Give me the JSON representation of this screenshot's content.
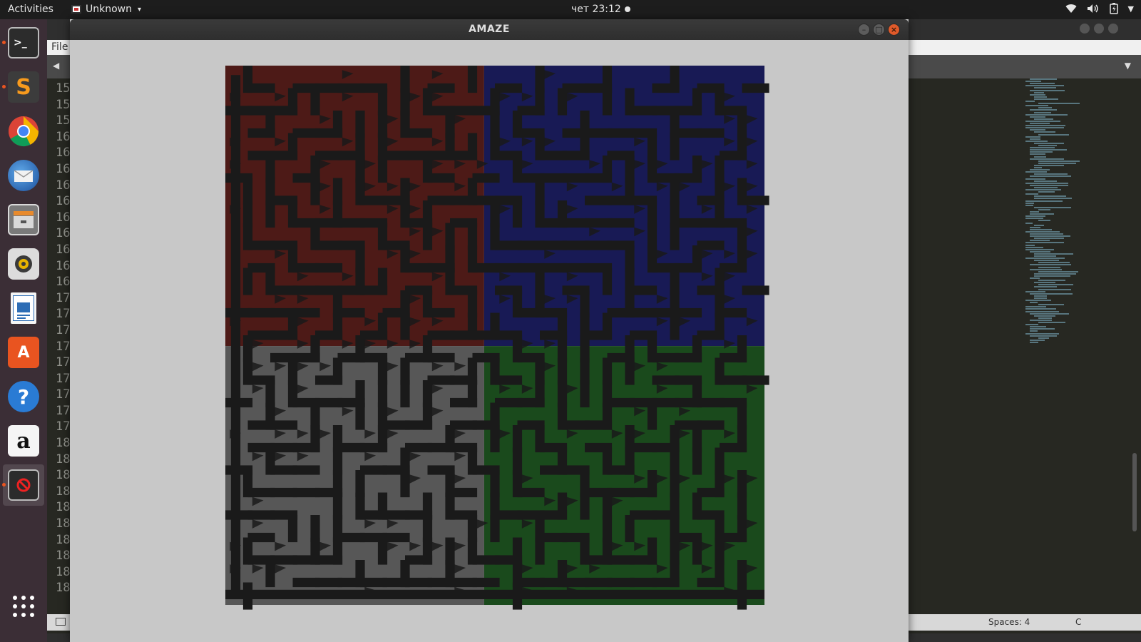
{
  "topbar": {
    "activities": "Activities",
    "app_name": "Unknown",
    "clock": "чет 23:12",
    "icons": [
      "wifi-icon",
      "volume-icon",
      "battery-icon",
      "system-menu-caret-icon"
    ]
  },
  "dock": {
    "items": [
      "terminal-icon",
      "sublime-text-icon",
      "chrome-icon",
      "thunderbird-icon",
      "file-manager-icon",
      "rhythmbox-icon",
      "libreoffice-writer-icon",
      "software-center-icon",
      "help-icon",
      "amazon-icon",
      "running-app-icon",
      "show-applications-icon"
    ]
  },
  "editor": {
    "menu_file": "File",
    "gutter_lines": [
      "15",
      "15",
      "15",
      "16",
      "16",
      "16",
      "16",
      "16",
      "16",
      "16",
      "16",
      "16",
      "16",
      "17",
      "17",
      "17",
      "17",
      "17",
      "17",
      "17",
      "17",
      "17",
      "18",
      "18",
      "18",
      "18",
      "18",
      "18",
      "18",
      "18",
      "18",
      "18"
    ],
    "status_spaces": "Spaces: 4",
    "status_lang": "C"
  },
  "amaze": {
    "title": "AMAZE",
    "colors": {
      "red_quadrant": "#4d1a17",
      "blue_quadrant": "#181a55",
      "gray_quadrant": "#575757",
      "green_quadrant": "#1a4a1c",
      "walls": "#1a1a1a",
      "background": "#c8c8c8"
    }
  },
  "colors": {
    "topbar": "#1d1d1d",
    "dock": "#3b2e36",
    "accent": "#e95420"
  }
}
